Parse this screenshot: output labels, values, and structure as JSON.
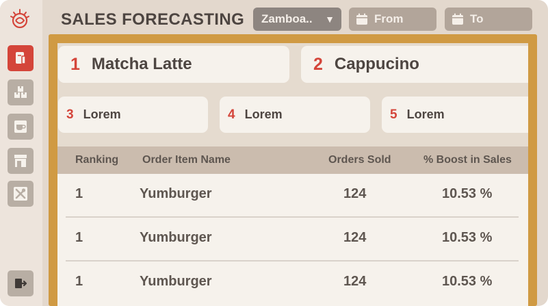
{
  "header": {
    "title": "SALES FORECASTING",
    "location_value": "Zamboa..",
    "from_label": "From",
    "to_label": "To"
  },
  "sidebar": {
    "items": [
      {
        "icon": "document-icon",
        "active": true
      },
      {
        "icon": "boxes-icon",
        "active": false
      },
      {
        "icon": "coffee-cup-icon",
        "active": false
      },
      {
        "icon": "store-icon",
        "active": false
      },
      {
        "icon": "tools-icon",
        "active": false
      }
    ],
    "logout_icon": "logout-icon"
  },
  "top_items": [
    {
      "rank": "1",
      "name": "Matcha Latte"
    },
    {
      "rank": "2",
      "name": "Cappucino"
    },
    {
      "rank": "3",
      "name": "Lorem"
    },
    {
      "rank": "4",
      "name": "Lorem"
    },
    {
      "rank": "5",
      "name": "Lorem"
    }
  ],
  "table": {
    "headers": [
      "Ranking",
      "Order Item Name",
      "Orders Sold",
      "% Boost in Sales"
    ],
    "rows": [
      [
        "1",
        "Yumburger",
        "124",
        "10.53 %"
      ],
      [
        "1",
        "Yumburger",
        "124",
        "10.53 %"
      ],
      [
        "1",
        "Yumburger",
        "124",
        "10.53 %"
      ]
    ]
  },
  "colors": {
    "accent": "#d4453a",
    "panel_border": "#d09a43",
    "text": "#4d4541"
  }
}
